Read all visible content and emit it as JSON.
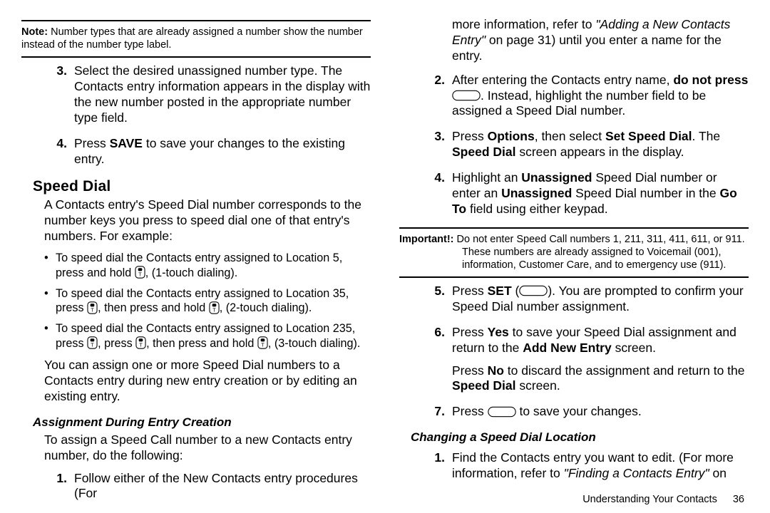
{
  "left": {
    "note_label": "Note:",
    "note_text": "Number types that are already assigned a number show the number instead of the number type label.",
    "step3": "Select the desired unassigned number type. The Contacts entry information appears in the display with the new number posted in the appropriate number type field.",
    "step4_a": "Press ",
    "step4_save": "SAVE",
    "step4_b": " to save your changes to the existing entry.",
    "h_speed": "Speed Dial",
    "intro": "A Contacts entry's Speed Dial number corresponds to the number keys you press to speed dial one of that entry's numbers. For example:",
    "b1_a": "To speed dial the Contacts entry assigned to Location 5, press and hold ",
    "b1_b": ", (1-touch dialing).",
    "b2_a": "To speed dial the Contacts entry assigned to Location 35, press ",
    "b2_b": ", then press and hold ",
    "b2_c": ", (2-touch dialing).",
    "b3_a": "To speed dial the Contacts entry assigned to Location 235, press ",
    "b3_b": ", press ",
    "b3_c": ", then press and hold ",
    "b3_d": ", (3-touch dialing).",
    "para2": "You can assign one or more Speed Dial numbers to a Contacts entry during new entry creation or by editing an existing entry.",
    "h_assign": "Assignment During Entry Creation",
    "assign_para": "To assign a Speed Call number to a new Contacts entry number, do the following:",
    "assign_step1": "Follow either of the New Contacts entry procedures (For"
  },
  "right": {
    "cont_a": "more information, refer to ",
    "cont_ref": "\"Adding a New Contacts Entry\"",
    "cont_b": " on page 31) until you enter a name for the entry.",
    "step2_a": "After entering the Contacts entry name, ",
    "step2_bold": "do not press",
    "step2_b": ". Instead, highlight the number field to be assigned a Speed Dial number.",
    "step3_a": "Press ",
    "step3_opt": "Options",
    "step3_b": ", then select ",
    "step3_set": "Set Speed Dial",
    "step3_c": ". The ",
    "step3_sd": "Speed Dial",
    "step3_d": " screen appears in the display.",
    "step4_a": "Highlight an ",
    "step4_un1": "Unassigned",
    "step4_b": " Speed Dial number or enter an ",
    "step4_un2": "Unassigned",
    "step4_c": " Speed Dial number in the ",
    "step4_goto": "Go To",
    "step4_d": " field using either keypad.",
    "imp_label": "Important!:",
    "imp_text1": "Do not enter Speed Call numbers 1, 211, 311, 411, 611, or 911.",
    "imp_text2": "These numbers are already assigned to Voicemail (001), information, Customer Care, and to emergency use (911).",
    "step5_a": "Press ",
    "step5_set": "SET",
    "step5_b": " (",
    "step5_c": "). You are prompted to confirm your Speed Dial number assignment.",
    "step6_a": "Press ",
    "step6_yes": "Yes",
    "step6_b": " to save your Speed Dial assignment and return to the ",
    "step6_add": "Add New Entry",
    "step6_c": " screen.",
    "step6_d": "Press ",
    "step6_no": "No",
    "step6_e": " to discard the assignment and return to the ",
    "step6_sd": "Speed Dial",
    "step6_f": " screen.",
    "step7_a": "Press ",
    "step7_b": " to save your changes.",
    "h_change": "Changing a Speed Dial Location",
    "chg1_a": "Find the Contacts entry you want to edit. (For more information, refer to ",
    "chg1_ref": "\"Finding a Contacts Entry\"",
    "chg1_b": "  on",
    "footer_text": "Understanding Your Contacts",
    "footer_page": "36"
  }
}
